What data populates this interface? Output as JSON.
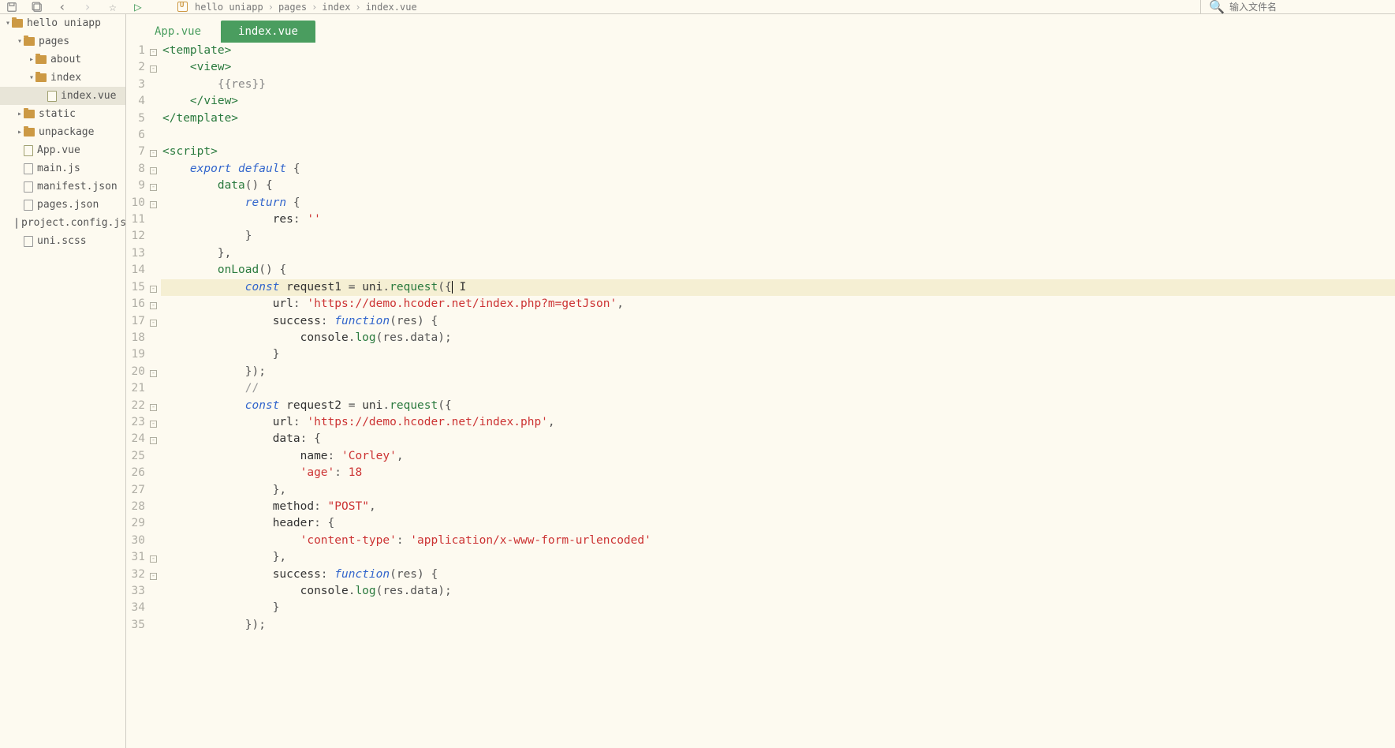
{
  "toolbar": {
    "search_placeholder": "输入文件名"
  },
  "breadcrumb": {
    "items": [
      "hello uniapp",
      "pages",
      "index",
      "index.vue"
    ]
  },
  "sidebar": {
    "tree": [
      {
        "indent": 1,
        "chev": "▾",
        "icon": "folder",
        "label": "hello uniapp"
      },
      {
        "indent": 2,
        "chev": "▾",
        "icon": "folder",
        "label": "pages"
      },
      {
        "indent": 3,
        "chev": "▸",
        "icon": "folder",
        "label": "about"
      },
      {
        "indent": 3,
        "chev": "▾",
        "icon": "folder",
        "label": "index"
      },
      {
        "indent": 4,
        "chev": "",
        "icon": "file-vue",
        "label": "index.vue",
        "selected": true
      },
      {
        "indent": 2,
        "chev": "▸",
        "icon": "folder",
        "label": "static"
      },
      {
        "indent": 2,
        "chev": "▸",
        "icon": "folder",
        "label": "unpackage"
      },
      {
        "indent": 2,
        "chev": "",
        "icon": "file-vue",
        "label": "App.vue"
      },
      {
        "indent": 2,
        "chev": "",
        "icon": "file",
        "label": "main.js"
      },
      {
        "indent": 2,
        "chev": "",
        "icon": "file",
        "label": "manifest.json"
      },
      {
        "indent": 2,
        "chev": "",
        "icon": "file",
        "label": "pages.json"
      },
      {
        "indent": 2,
        "chev": "",
        "icon": "file",
        "label": "project.config.json"
      },
      {
        "indent": 2,
        "chev": "",
        "icon": "file",
        "label": "uni.scss"
      }
    ]
  },
  "tabs": {
    "items": [
      {
        "label": "App.vue",
        "active": false
      },
      {
        "label": "index.vue",
        "active": true
      }
    ]
  },
  "editor": {
    "highlighted_line": 15,
    "lines_count": 35,
    "fold_lines": [
      1,
      2,
      7,
      8,
      9,
      10,
      15,
      16,
      17,
      20,
      22,
      23,
      24,
      31,
      32
    ],
    "cursor_line": 15,
    "code": {
      "l1": {
        "t1": "<template>"
      },
      "l2": {
        "t1": "<view>"
      },
      "l3": {
        "t1": "{{res}}"
      },
      "l4": {
        "t1": "</view>"
      },
      "l5": {
        "t1": "</template>"
      },
      "l6": {
        "t1": ""
      },
      "l7": {
        "t1": "<script",
        "t2": ">"
      },
      "l8": {
        "t1": "export",
        "t2": "default",
        "t3": "{"
      },
      "l9": {
        "t1": "data",
        "t2": "()",
        "t3": "{"
      },
      "l10": {
        "t1": "return",
        "t2": "{"
      },
      "l11": {
        "t1": "res",
        "t2": ":",
        "t3": "''"
      },
      "l12": {
        "t1": "}"
      },
      "l13": {
        "t1": "},"
      },
      "l14": {
        "t1": "onLoad",
        "t2": "()",
        "t3": "{"
      },
      "l15": {
        "t1": "const",
        "t2": "request1",
        "t3": "=",
        "t4": "uni",
        "t5": ".",
        "t6": "request",
        "t7": "({",
        "t8": "I"
      },
      "l16": {
        "t1": "url",
        "t2": ":",
        "t3": "'https://demo.hcoder.net/index.php?m=getJson'",
        "t4": ","
      },
      "l17": {
        "t1": "success",
        "t2": ":",
        "t3": "function",
        "t4": "(res)",
        "t5": "{"
      },
      "l18": {
        "t1": "console",
        "t2": ".",
        "t3": "log",
        "t4": "(res.data);"
      },
      "l19": {
        "t1": "}"
      },
      "l20": {
        "t1": "});"
      },
      "l21": {
        "t1": "//"
      },
      "l22": {
        "t1": "const",
        "t2": "request2",
        "t3": "=",
        "t4": "uni",
        "t5": ".",
        "t6": "request",
        "t7": "({"
      },
      "l23": {
        "t1": "url",
        "t2": ":",
        "t3": "'https://demo.hcoder.net/index.php'",
        "t4": ","
      },
      "l24": {
        "t1": "data",
        "t2": ":",
        "t3": "{"
      },
      "l25": {
        "t1": "name",
        "t2": ":",
        "t3": "'Corley'",
        "t4": ","
      },
      "l26": {
        "t1": "'age'",
        "t2": ":",
        "t3": "18"
      },
      "l27": {
        "t1": "},"
      },
      "l28": {
        "t1": "method",
        "t2": ":",
        "t3": "\"POST\"",
        "t4": ","
      },
      "l29": {
        "t1": "header",
        "t2": ":",
        "t3": "{"
      },
      "l30": {
        "t1": "'content-type'",
        "t2": ":",
        "t3": "'application/x-www-form-urlencoded'"
      },
      "l31": {
        "t1": "},"
      },
      "l32": {
        "t1": "success",
        "t2": ":",
        "t3": "function",
        "t4": "(res)",
        "t5": "{"
      },
      "l33": {
        "t1": "console",
        "t2": ".",
        "t3": "log",
        "t4": "(res.data);"
      },
      "l34": {
        "t1": "}"
      },
      "l35": {
        "t1": "});"
      }
    }
  }
}
